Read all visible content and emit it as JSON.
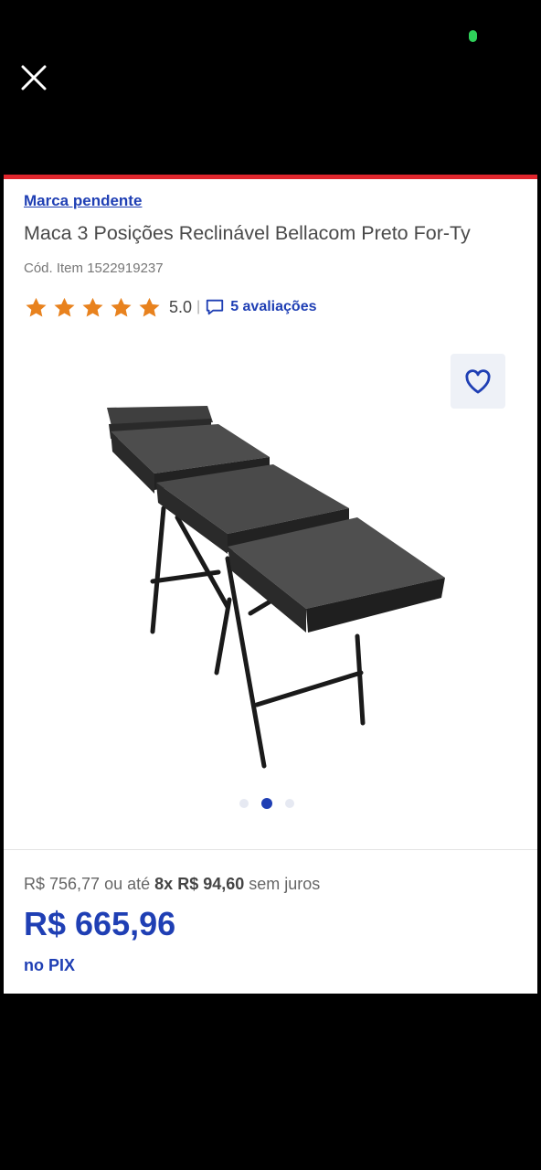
{
  "product": {
    "brand_link": "Marca pendente",
    "title": "Maca 3 Posições Reclinável Bellacom Preto For-Ty",
    "item_code": "Cód. Item 1522919237",
    "rating_value": "5.0",
    "rating_separator": "|",
    "reviews_label": "5 avaliações",
    "stars_filled": 5
  },
  "gallery": {
    "dots": 3,
    "active_index": 1
  },
  "pricing": {
    "original_price": "R$ 756,77",
    "installment_prefix": "ou até",
    "installment_count": "8x",
    "installment_value": "R$ 94,60",
    "installment_suffix": "sem juros",
    "pix_price": "R$ 665,96",
    "pix_label": "no PIX"
  },
  "colors": {
    "accent_blue": "#1f3fb4",
    "star_orange": "#e8821e",
    "top_bar_red": "#e0262d"
  },
  "icons": {
    "close": "close-icon",
    "favorite": "heart-icon",
    "reviews": "chat-bubble-icon",
    "star": "star-icon"
  }
}
